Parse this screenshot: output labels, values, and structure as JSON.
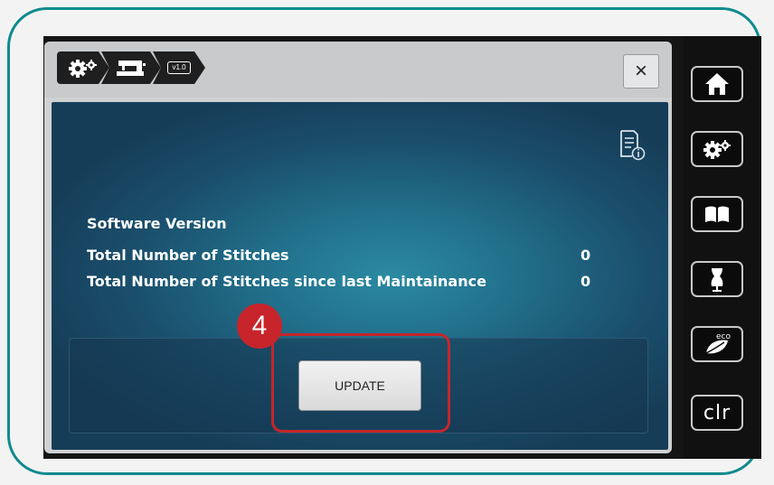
{
  "breadcrumb": {
    "items": [
      {
        "icon": "gears-icon"
      },
      {
        "icon": "sewing-machine-icon"
      },
      {
        "label": "v1.0"
      }
    ]
  },
  "window": {
    "close_label": "×"
  },
  "info": {
    "software_version_label": "Software Version",
    "software_version_value": "",
    "total_stitches_label": "Total Number of Stitches",
    "total_stitches_value": "0",
    "stitches_since_maintenance_label": "Total Number of Stitches since last Maintainance",
    "stitches_since_maintenance_value": "0"
  },
  "update": {
    "button_label": "UPDATE"
  },
  "annotation": {
    "step_number": "4",
    "highlight_color": "#c7252b"
  },
  "sidebar": {
    "items": [
      {
        "icon": "home-icon"
      },
      {
        "icon": "settings-gears-icon"
      },
      {
        "icon": "book-icon"
      },
      {
        "icon": "dress-form-icon"
      },
      {
        "icon": "eco-leaf-icon",
        "label": "eco"
      },
      {
        "label": "clr"
      }
    ]
  },
  "colors": {
    "frame_accent": "#0f8a8e",
    "content_gradient_center": "#2b8aa2",
    "content_gradient_edge": "#163d58"
  }
}
